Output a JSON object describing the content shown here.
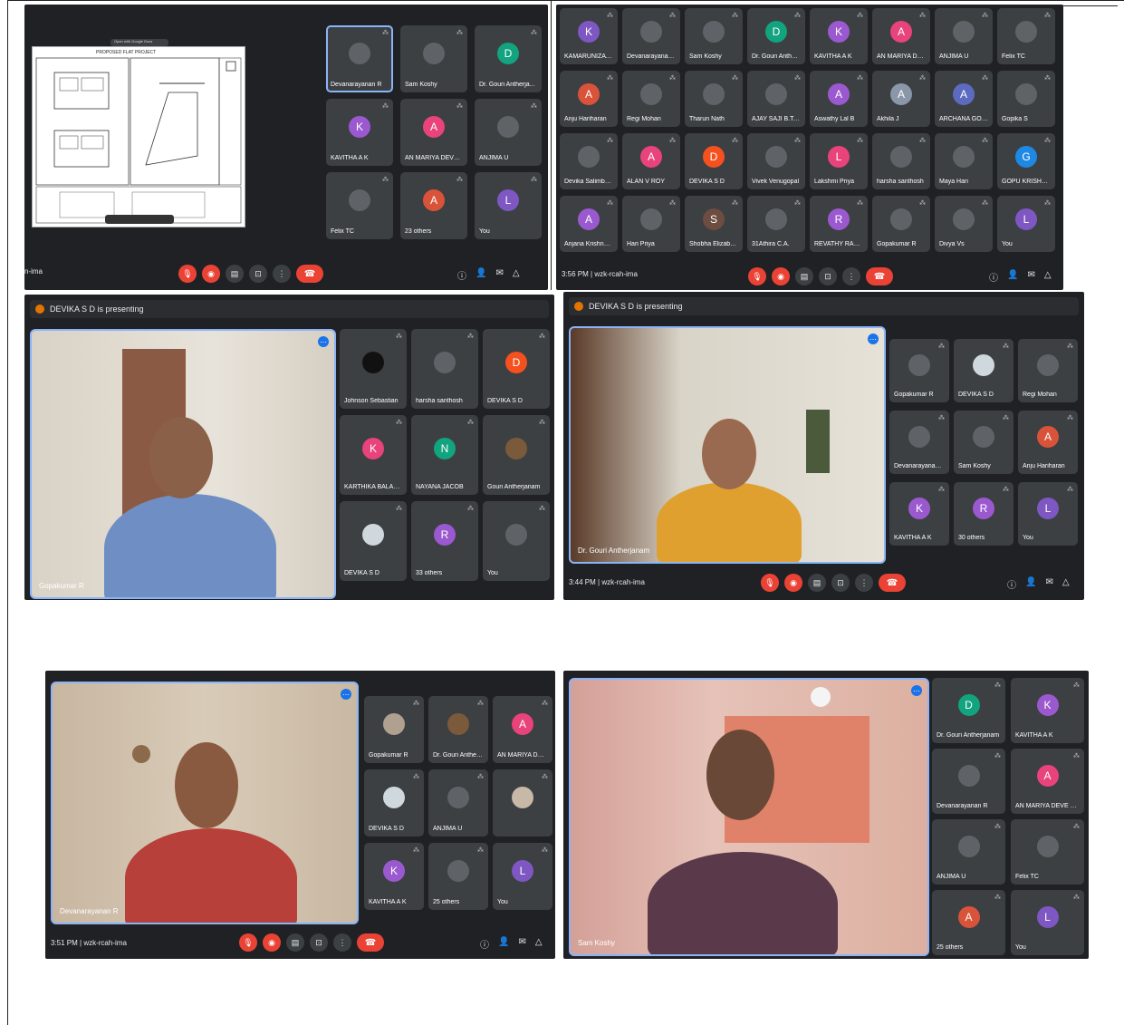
{
  "shot1": {
    "doc_tab": "Open with Google Docs",
    "doc_title": "PROPOSED FLAT PROJECT",
    "meeting_code": "n-ima",
    "tiles": [
      {
        "name": "Devanarayanan R",
        "letter": "",
        "color": "#5f6368"
      },
      {
        "name": "Sam Koshy",
        "letter": "",
        "color": "#5f6368"
      },
      {
        "name": "Dr. Gouri Antherja...",
        "letter": "D",
        "color": "#12a37f"
      },
      {
        "name": "KAVITHA A K",
        "letter": "K",
        "color": "#9b59d0"
      },
      {
        "name": "AN MARIYA DEVE ...",
        "letter": "A",
        "color": "#e8437a"
      },
      {
        "name": "ANJIMA U",
        "letter": "",
        "color": "#5f6368"
      },
      {
        "name": "Felix TC",
        "letter": "",
        "color": "#5f6368"
      },
      {
        "name": "23 others",
        "letter": "A",
        "color": "#d9533a"
      },
      {
        "name": "You",
        "letter": "L",
        "color": "#7e57c2"
      }
    ]
  },
  "shot2": {
    "time": "3:56 PM",
    "meeting_code": "wzk-rcah-ima",
    "tiles": [
      {
        "name": "KAMARUNIZA K S",
        "letter": "K",
        "color": "#7e57c2"
      },
      {
        "name": "Devanarayanan R",
        "letter": "",
        "color": "#5f6368"
      },
      {
        "name": "Sam Koshy",
        "letter": "",
        "color": "#5f6368"
      },
      {
        "name": "Dr. Gouri Antherja...",
        "letter": "D",
        "color": "#12a37f"
      },
      {
        "name": "KAVITHA A K",
        "letter": "K",
        "color": "#9b59d0"
      },
      {
        "name": "AN MARIYA DEVE ...",
        "letter": "A",
        "color": "#e8437a"
      },
      {
        "name": "ANJIMA U",
        "letter": "",
        "color": "#5f6368"
      },
      {
        "name": "Felix TC",
        "letter": "",
        "color": "#5f6368"
      },
      {
        "name": "Anju Hariharan",
        "letter": "A",
        "color": "#d9533a"
      },
      {
        "name": "Regi Mohan",
        "letter": "",
        "color": "#5f6368"
      },
      {
        "name": "Tharun Nath",
        "letter": "",
        "color": "#5f6368"
      },
      {
        "name": "AJAY SAJI B.Tech...",
        "letter": "",
        "color": "#5f6368"
      },
      {
        "name": "Aswathy Lal B",
        "letter": "A",
        "color": "#9b59d0"
      },
      {
        "name": "Akhila J",
        "letter": "A",
        "color": "#8a97a8"
      },
      {
        "name": "ARCHANA GOPINA...",
        "letter": "A",
        "color": "#5c6bc0"
      },
      {
        "name": "Gopika S",
        "letter": "",
        "color": "#5f6368"
      },
      {
        "name": "Devika Salimbabu",
        "letter": "",
        "color": "#5f6368"
      },
      {
        "name": "ALAN V ROY",
        "letter": "A",
        "color": "#e8437a"
      },
      {
        "name": "DEVIKA S D",
        "letter": "D",
        "color": "#f4511e"
      },
      {
        "name": "Vivek Venugopal",
        "letter": "",
        "color": "#5f6368"
      },
      {
        "name": "Lakshmi Priya",
        "letter": "L",
        "color": "#e8437a"
      },
      {
        "name": "harsha santhosh",
        "letter": "",
        "color": "#5f6368"
      },
      {
        "name": "Maya Hari",
        "letter": "",
        "color": "#5f6368"
      },
      {
        "name": "GOPU KRISHNAN",
        "letter": "G",
        "color": "#1e88e5"
      },
      {
        "name": "Anjana Krishna KU",
        "letter": "A",
        "color": "#9b59d0"
      },
      {
        "name": "Hari Priya",
        "letter": "",
        "color": "#5f6368"
      },
      {
        "name": "Shobha Elizabeth...",
        "letter": "S",
        "color": "#6d4c41"
      },
      {
        "name": "31Athira C.A.",
        "letter": "",
        "color": "#5f6368"
      },
      {
        "name": "REVATHY RADHAK...",
        "letter": "R",
        "color": "#9b59d0"
      },
      {
        "name": "Gopakumar R",
        "letter": "",
        "color": "#5f6368"
      },
      {
        "name": "Divya Vs",
        "letter": "",
        "color": "#5f6368"
      },
      {
        "name": "You",
        "letter": "L",
        "color": "#7e57c2"
      }
    ]
  },
  "shot3": {
    "presenting": "DEVIKA S D is presenting",
    "main_name": "Gopakumar R",
    "tiles": [
      {
        "name": "Johnson Sebastian",
        "letter": "",
        "color": "#111"
      },
      {
        "name": "harsha santhosh",
        "letter": "",
        "color": "#5f6368"
      },
      {
        "name": "DEVIKA S D",
        "letter": "D",
        "color": "#f4511e"
      },
      {
        "name": "KARTHIKA BALAKR...",
        "letter": "K",
        "color": "#e8437a"
      },
      {
        "name": "NAYANA JACOB",
        "letter": "N",
        "color": "#12a37f"
      },
      {
        "name": "Gouri Antherjanam",
        "letter": "",
        "color": "#7a5a3a"
      },
      {
        "name": "DEVIKA S D",
        "letter": "",
        "color": "#cfd8dc"
      },
      {
        "name": "33 others",
        "letter": "R",
        "color": "#9b59d0"
      },
      {
        "name": "You",
        "letter": "",
        "color": "#5f6368"
      }
    ]
  },
  "shot4": {
    "presenting": "DEVIKA S D is presenting",
    "main_name": "Dr. Gouri Antherjanam",
    "time": "3:44 PM",
    "meeting_code": "wzk-rcah-ima",
    "tiles": [
      {
        "name": "Gopakumar R",
        "letter": "",
        "color": "#5f6368"
      },
      {
        "name": "DEVIKA S D",
        "letter": "",
        "color": "#cfd8dc"
      },
      {
        "name": "Regi Mohan",
        "letter": "",
        "color": "#5f6368"
      },
      {
        "name": "Devanarayanan R",
        "letter": "",
        "color": "#5f6368"
      },
      {
        "name": "Sam Koshy",
        "letter": "",
        "color": "#5f6368"
      },
      {
        "name": "Anju Hariharan",
        "letter": "A",
        "color": "#d9533a"
      },
      {
        "name": "KAVITHA A K",
        "letter": "K",
        "color": "#9b59d0"
      },
      {
        "name": "30 others",
        "letter": "R",
        "color": "#9b59d0"
      },
      {
        "name": "You",
        "letter": "L",
        "color": "#7e57c2"
      }
    ]
  },
  "shot5": {
    "main_name": "Devanarayanan R",
    "time": "3:51 PM",
    "meeting_code": "wzk-rcah-ima",
    "tiles": [
      {
        "name": "Gopakumar R",
        "letter": "",
        "color": "#b0a090"
      },
      {
        "name": "Dr. Gouri Antherja...",
        "letter": "",
        "color": "#7a5a3a"
      },
      {
        "name": "AN MARIYA DEVE ...",
        "letter": "A",
        "color": "#e8437a"
      },
      {
        "name": "DEVIKA S D",
        "letter": "",
        "color": "#cfd8dc"
      },
      {
        "name": "ANJIMA U",
        "letter": "",
        "color": "#5f6368"
      },
      {
        "name": "",
        "letter": "",
        "color": "#c8b8a8"
      },
      {
        "name": "KAVITHA A K",
        "letter": "K",
        "color": "#9b59d0"
      },
      {
        "name": "25 others",
        "letter": "",
        "color": "#5f6368"
      },
      {
        "name": "You",
        "letter": "L",
        "color": "#7e57c2"
      }
    ]
  },
  "shot6": {
    "main_name": "Sam Koshy",
    "tiles": [
      {
        "name": "Dr. Gouri Antherjanam",
        "letter": "D",
        "color": "#12a37f"
      },
      {
        "name": "KAVITHA A K",
        "letter": "K",
        "color": "#9b59d0"
      },
      {
        "name": "Devanarayanan R",
        "letter": "",
        "color": "#5f6368"
      },
      {
        "name": "AN MARIYA DEVE M D B...",
        "letter": "A",
        "color": "#e8437a"
      },
      {
        "name": "ANJIMA U",
        "letter": "",
        "color": "#5f6368"
      },
      {
        "name": "Felix TC",
        "letter": "",
        "color": "#5f6368"
      },
      {
        "name": "25 others",
        "letter": "A",
        "color": "#d9533a"
      },
      {
        "name": "You",
        "letter": "L",
        "color": "#7e57c2"
      }
    ]
  }
}
